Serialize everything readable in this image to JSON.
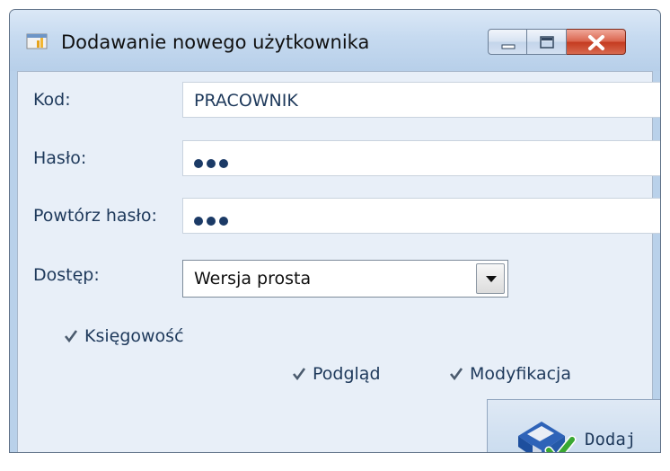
{
  "window": {
    "title": "Dodawanie nowego użytkownika",
    "icons": {
      "app": "app-icon",
      "minimize": "minimize-icon",
      "maximize": "maximize-icon",
      "close": "close-icon"
    },
    "colors": {
      "titlebar": "#c6daf0",
      "panel": "#e8eff8",
      "text": "#1e395b",
      "close": "#c43a1f"
    }
  },
  "form": {
    "kod": {
      "label": "Kod:",
      "value": "PRACOWNIK"
    },
    "haslo": {
      "label": "Hasło:",
      "masked_length": 3
    },
    "powtorz": {
      "label": "Powtórz hasło:",
      "masked_length": 3
    },
    "dostep": {
      "label": "Dostęp:",
      "selected": "Wersja prosta",
      "icon": "chevron-down-icon"
    }
  },
  "checkboxes": {
    "ksiegowosc": {
      "label": "Księgowość",
      "checked": true
    },
    "podglad": {
      "label": "Podgląd",
      "checked": true
    },
    "modyfikacja": {
      "label": "Modyfikacja",
      "checked": true
    }
  },
  "actions": {
    "dodaj": {
      "label": "Dodaj",
      "icon": "save-check-icon"
    }
  }
}
